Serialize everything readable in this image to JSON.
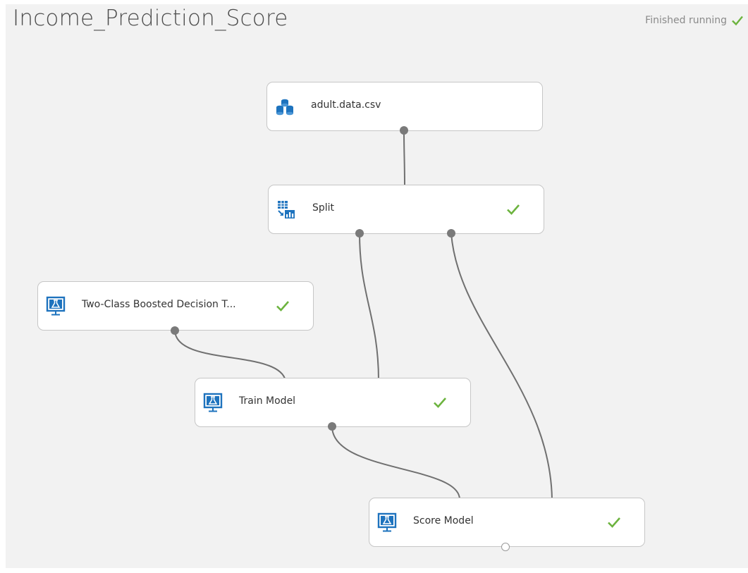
{
  "experiment": {
    "title": "Income_Prediction_Score",
    "status": "Finished running",
    "status_color": "#6cb33e"
  },
  "modules": [
    {
      "id": "dataset",
      "label": "adult.data.csv",
      "icon": "dataset-icon",
      "completed": false
    },
    {
      "id": "split",
      "label": "Split",
      "icon": "split-data-icon",
      "completed": true
    },
    {
      "id": "boosted",
      "label": "Two-Class Boosted Decision T...",
      "icon": "ml-model-icon",
      "completed": true
    },
    {
      "id": "train",
      "label": "Train Model",
      "icon": "ml-model-icon",
      "completed": true
    },
    {
      "id": "score",
      "label": "Score Model",
      "icon": "ml-model-icon",
      "completed": true
    }
  ],
  "connections": [
    {
      "from": "adult.data.csv",
      "to": "Split"
    },
    {
      "from": "Split",
      "to": "Train Model"
    },
    {
      "from": "Split",
      "to": "Score Model"
    },
    {
      "from": "Two-Class Boosted Decision T...",
      "to": "Train Model"
    },
    {
      "from": "Train Model",
      "to": "Score Model"
    }
  ],
  "colors": {
    "canvas": "#f2f2f2",
    "icon_blue": "#1e73be",
    "check_green": "#6cb33e",
    "wire": "#707070"
  }
}
